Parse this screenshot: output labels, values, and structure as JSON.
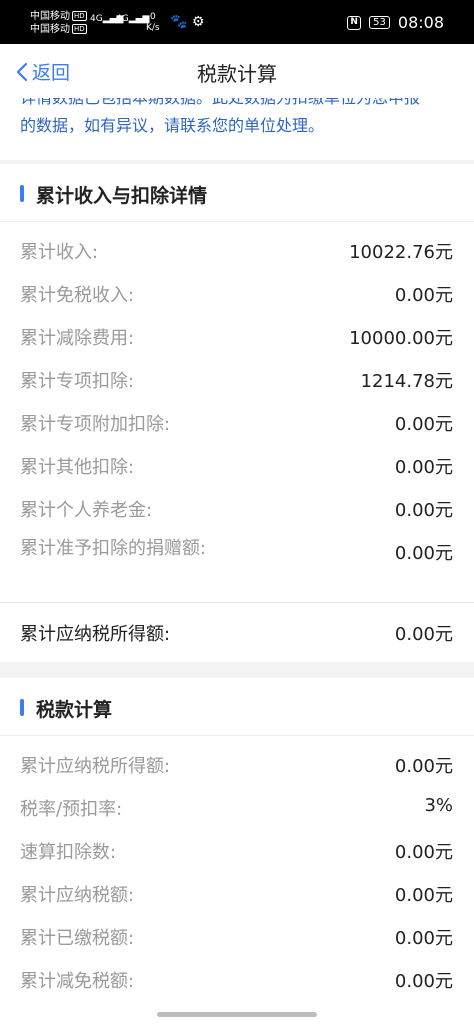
{
  "status_bar": {
    "carrier1": "中国移动",
    "carrier2": "中国移动",
    "hd": "HD",
    "net1": "4G",
    "net2": "4G",
    "speed_value": "0",
    "speed_unit": "K/s",
    "battery": "53",
    "time": "08:08"
  },
  "nav": {
    "back_label": "返回",
    "title": "税款计算"
  },
  "notice": {
    "line1": "详情数据已包括本期数据。此处数据为扣缴单位为您申报",
    "line2": "的数据，如有异议，请联系您的单位处理。"
  },
  "section1": {
    "title": "累计收入与扣除详情",
    "rows": [
      {
        "label": "累计收入:",
        "value": "10022.76元"
      },
      {
        "label": "累计免税收入:",
        "value": "0.00元"
      },
      {
        "label": "累计减除费用:",
        "value": "10000.00元"
      },
      {
        "label": "累计专项扣除:",
        "value": "1214.78元"
      },
      {
        "label": "累计专项附加扣除:",
        "value": "0.00元"
      },
      {
        "label": "累计其他扣除:",
        "value": "0.00元"
      },
      {
        "label": "累计个人养老金:",
        "value": "0.00元"
      },
      {
        "label": "累计准予扣除的捐赠额:",
        "value": "0.00元"
      }
    ],
    "total": {
      "label": "累计应纳税所得额:",
      "value": "0.00元"
    }
  },
  "section2": {
    "title": "税款计算",
    "rows": [
      {
        "label": "累计应纳税所得额:",
        "value": "0.00元"
      },
      {
        "label": "税率/预扣率:",
        "value": "3%"
      },
      {
        "label": "速算扣除数:",
        "value": "0.00元"
      },
      {
        "label": "累计应纳税额:",
        "value": "0.00元"
      },
      {
        "label": "累计已缴税额:",
        "value": "0.00元"
      },
      {
        "label": "累计减免税额:",
        "value": "0.00元"
      }
    ]
  }
}
